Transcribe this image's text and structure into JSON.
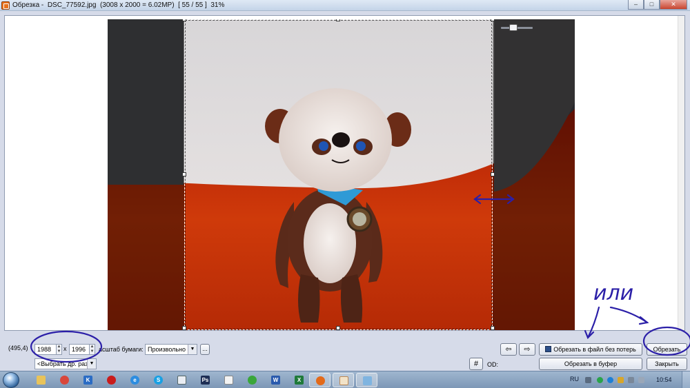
{
  "window": {
    "title": "Обрезка -  DSC_77592.jpg  (3008 x 2000 = 6.02MP)  [ 55 / 55 ]  31%",
    "minimize": "–",
    "maximize": "□",
    "close": "✕"
  },
  "toolbar": {
    "coords": "(495,4)",
    "width_value": "1988",
    "x_sep": "x",
    "height_value": "1996",
    "paper_scale_label": "асштаб бумаги:",
    "paper_scale_value": "Произвольно",
    "more_button": "...",
    "other_size_value": "<Выбрать др. разм",
    "prev_button": "⇦",
    "next_button": "⇨",
    "grid_button": "#",
    "od_label": "OD:",
    "crop_to_file_button": "Обрезать в файл без потерь",
    "crop_button": "Обрезать",
    "crop_to_buffer_button": "Обрезать в буфер",
    "close_button": "Закрыть"
  },
  "annotation": {
    "text": "или",
    "color": "#2b1fa8"
  },
  "taskbar": {
    "language": "RU",
    "clock": "10:54",
    "apps": [
      "explorer-icon",
      "chrome-icon",
      "k-icon",
      "opera-icon",
      "ie-icon",
      "skype-icon",
      "window-icon",
      "photoshop-icon",
      "document-icon",
      "refresh-icon",
      "word-icon",
      "excel-icon",
      "firefox-icon",
      "faststone-icon",
      "paint-icon"
    ]
  },
  "colors": {
    "selection": "#ffffff",
    "annotation": "#2b1fa8"
  }
}
